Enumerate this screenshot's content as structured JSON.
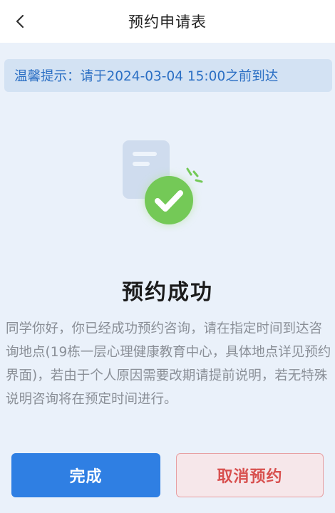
{
  "header": {
    "title": "预约申请表",
    "back_icon": "chevron-left-icon"
  },
  "notice": {
    "text": "温馨提示：请于2024-03-04 15:00之前到达"
  },
  "illustration": {
    "icons": [
      "document-icon",
      "checkmark-circle-icon",
      "sparkle-icon"
    ]
  },
  "result": {
    "title": "预约成功",
    "description": "同学你好，你已经成功预约咨询，请在指定时间到达咨询地点(19栋一层心理健康教育中心，具体地点详见预约界面)，若由于个人原因需要改期请提前说明，若无特殊说明咨询将在预定时间进行。"
  },
  "actions": {
    "done_label": "完成",
    "cancel_label": "取消预约"
  },
  "colors": {
    "background": "#eaf1fa",
    "notice_bg": "#d3e2f3",
    "notice_text": "#2b6fc4",
    "primary": "#2f7fe3",
    "danger_text": "#d8504f",
    "danger_bg": "#f6e7ea",
    "success_green": "#74c957"
  }
}
